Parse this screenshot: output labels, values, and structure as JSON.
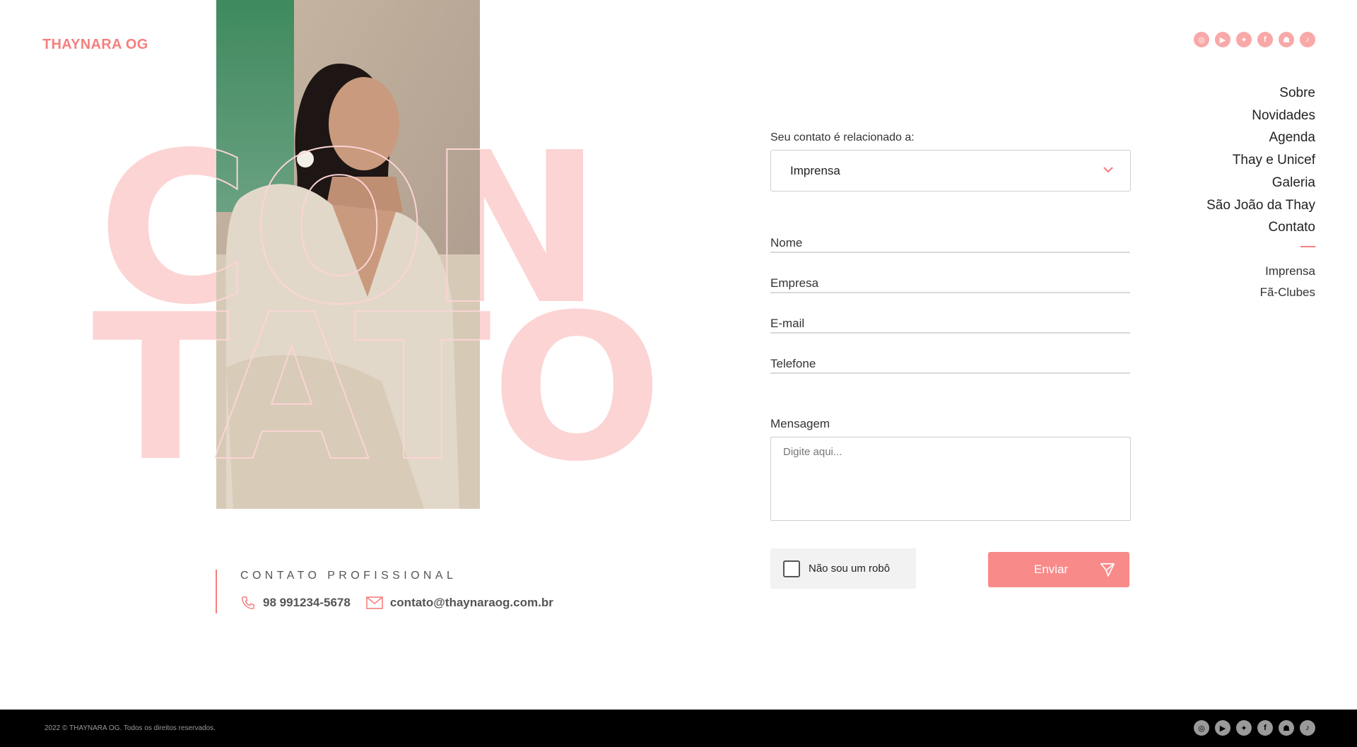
{
  "brand": {
    "logo_text": "THAYNARA OG",
    "accent": "#f57f7f",
    "accent_light": "#fcd4d4"
  },
  "social": [
    "instagram-icon",
    "youtube-icon",
    "twitter-icon",
    "facebook-icon",
    "snapchat-icon",
    "tiktok-icon"
  ],
  "nav": {
    "items": [
      "Sobre",
      "Novidades",
      "Agenda",
      "Thay e Unicef",
      "Galeria",
      "São João da Thay",
      "Contato"
    ],
    "sub_items": [
      "Imprensa",
      "Fã-Clubes"
    ]
  },
  "hero": {
    "word_top": "CON",
    "word_bottom": "TATO",
    "photo_alt": "portrait photo"
  },
  "contact_professional": {
    "title": "CONTATO PROFISSIONAL",
    "phone": "98 991234-5678",
    "email": "contato@thaynaraog.com.br"
  },
  "form": {
    "related_label": "Seu contato é relacionado a:",
    "related_value": "Imprensa",
    "fields": {
      "name": "Nome",
      "company": "Empresa",
      "email": "E-mail",
      "phone": "Telefone"
    },
    "message_label": "Mensagem",
    "message_placeholder": "Digite aqui...",
    "captcha_label": "Não sou um robô",
    "submit_label": "Enviar"
  },
  "footer": {
    "copyright": "2022 © THAYNARA OG. Todos os direitos reservados."
  }
}
